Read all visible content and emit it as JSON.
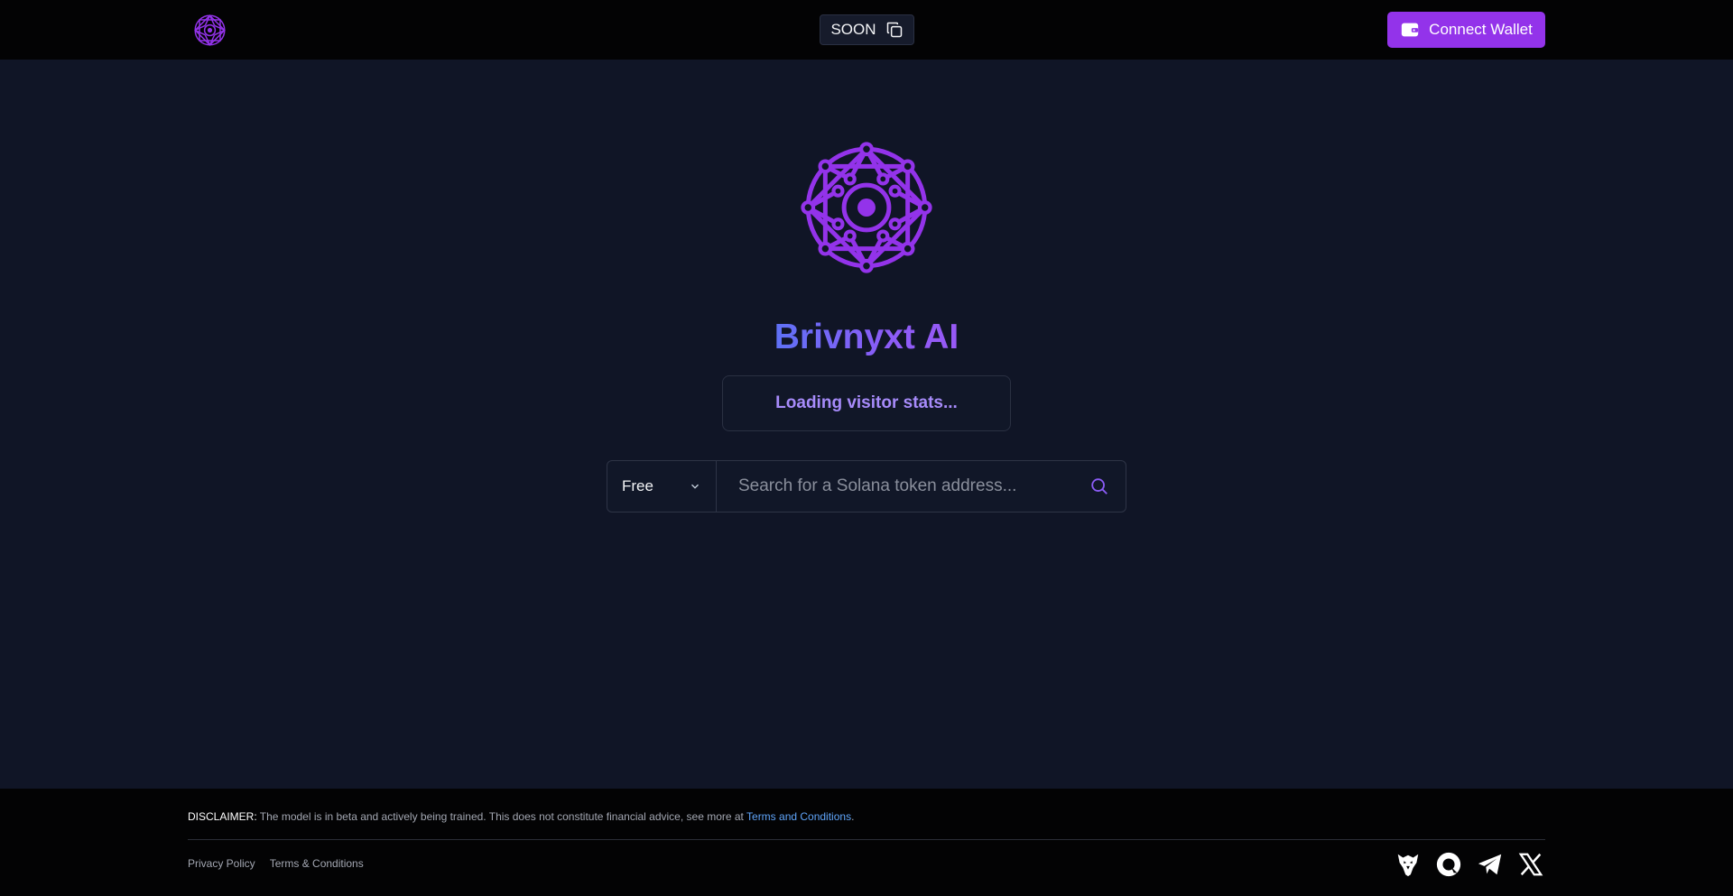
{
  "header": {
    "soon_label": "SOON",
    "connect_label": "Connect Wallet"
  },
  "hero": {
    "title": "Brivnyxt AI",
    "stats_text": "Loading visitor stats..."
  },
  "search": {
    "plan_selected": "Free",
    "placeholder": "Search for a Solana token address..."
  },
  "footer": {
    "disclaimer_label": "DISCLAIMER:",
    "disclaimer_text": " The model is in beta and actively being trained. This does not constitute financial advice, see more at ",
    "disclaimer_link": "Terms and Conditions",
    "disclaimer_end": ".",
    "links": [
      "Privacy Policy",
      "Terms & Conditions"
    ]
  },
  "icons": {
    "logo": "network-logo-icon",
    "soon": "copy-icon",
    "wallet": "wallet-icon",
    "dropdown": "chevron-down-icon",
    "search": "search-icon",
    "socials": [
      "eagle-icon",
      "chat-icon",
      "telegram-icon",
      "x-icon"
    ]
  },
  "colors": {
    "accent": "#9333ea",
    "header_bg": "#030304",
    "page_bg": "#101526",
    "link": "#60a5fa"
  }
}
